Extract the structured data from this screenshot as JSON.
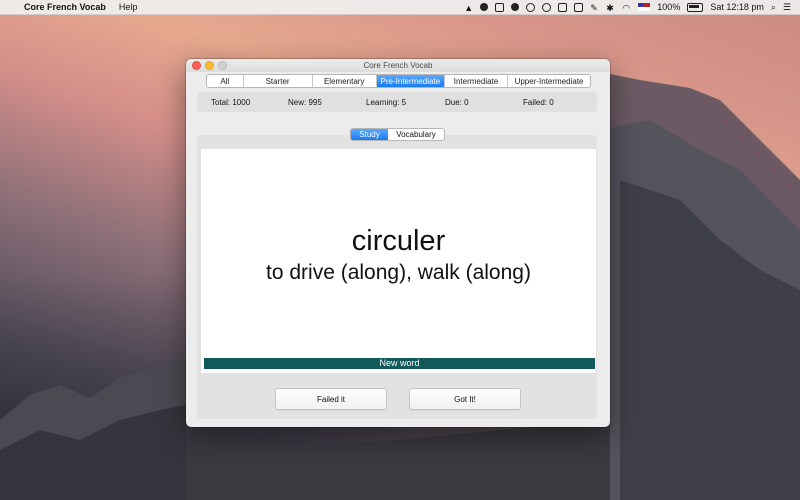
{
  "menubar": {
    "app_name": "Core French Vocab",
    "menus": [
      "Help"
    ],
    "status_icons": [
      "notification-icon",
      "drive-icon",
      "dropbox-icon",
      "evernote-icon",
      "sync-icon",
      "dnd-icon",
      "clipboard-icon",
      "window-icon",
      "pen-icon",
      "bluetooth-icon",
      "wifi-icon",
      "flag-icon"
    ],
    "battery": "100%",
    "clock": "Sat 12:18 pm"
  },
  "window": {
    "title": "Core French Vocab",
    "level_tabs": [
      "All",
      "Starter",
      "Elementary",
      "Pre-Intermediate",
      "Intermediate",
      "Upper-Intermediate"
    ],
    "active_level": "Pre-Intermediate",
    "stats": {
      "total": "Total: 1000",
      "new": "New: 995",
      "learning": "Learning: 5",
      "due": "Due: 0",
      "failed": "Failed: 0"
    },
    "mode_tabs": [
      "Study",
      "Vocabulary"
    ],
    "active_mode": "Study",
    "card": {
      "word": "circuler",
      "translation": "to drive (along), walk (along)",
      "status": "New word"
    },
    "buttons": {
      "failed": "Failed it",
      "got": "Got It!"
    }
  },
  "colors": {
    "accent": "#1a7bf2",
    "status_bar": "#12595c"
  }
}
